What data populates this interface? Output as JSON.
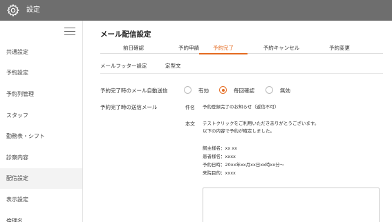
{
  "header": {
    "title": "設定"
  },
  "sidebar": {
    "items": [
      {
        "label": "共通設定"
      },
      {
        "label": "予約設定"
      },
      {
        "label": "予約列管理"
      },
      {
        "label": "スタッフ"
      },
      {
        "label": "勤務表・シフト"
      },
      {
        "label": "診察内容"
      },
      {
        "label": "配信設定"
      },
      {
        "label": "表示設定"
      },
      {
        "label": "倫理名"
      }
    ],
    "active_index": 6
  },
  "main": {
    "title": "メール配信設定",
    "tabs": [
      {
        "label": "前日確認"
      },
      {
        "label": "予約申請"
      },
      {
        "label": "予約完了"
      },
      {
        "label": "予約キャンセル"
      },
      {
        "label": "予約変更"
      }
    ],
    "active_tab": 2,
    "subtabs": [
      {
        "label": "メールフッター設定"
      },
      {
        "label": "定型文"
      }
    ],
    "auto_send": {
      "label": "予約完了時のメール自動送信",
      "options": [
        {
          "label": "有効"
        },
        {
          "label": "毎回確認"
        },
        {
          "label": "無効"
        }
      ],
      "selected_index": 1
    },
    "mail": {
      "label": "予約完了時の送信メール",
      "subject_tag": "件名",
      "subject": "予約登録完了のお知らせ（返信不可）",
      "body_tag": "本文",
      "body_lines": [
        "テストクリックをご利用いただきありがとうございます。",
        "以下の内容で予約が確定しました。",
        "",
        "飼主様名：xx xx",
        "患者様名：xxxx",
        "予約日時：20xx年xx月xx日xx時xx分〜",
        "来院目的：xxxx"
      ]
    }
  }
}
